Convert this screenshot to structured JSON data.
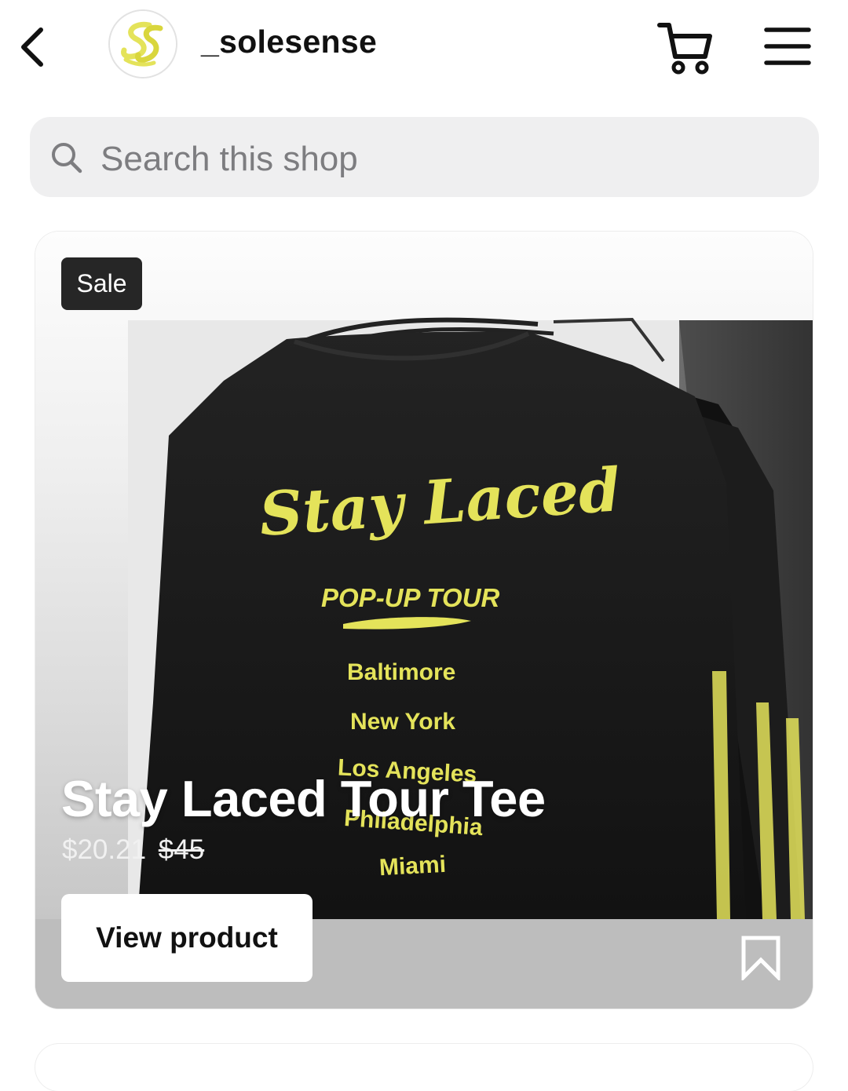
{
  "header": {
    "username": "_solesense",
    "icons": {
      "back": "back-chevron-icon",
      "avatar": "solesense-logo",
      "cart": "cart-icon",
      "menu": "hamburger-menu-icon"
    }
  },
  "search": {
    "placeholder": "Search this shop",
    "icon": "search-icon"
  },
  "product": {
    "badge": "Sale",
    "title": "Stay Laced Tour Tee",
    "price_current": "$20.21",
    "price_original": "$45",
    "cta": "View product",
    "save_icon": "bookmark-icon",
    "shirt_print": {
      "script_title": "Stay Laced",
      "subtitle": "POP-UP TOUR",
      "cities": [
        "Baltimore",
        "New York",
        "Los Angeles",
        "Philadelphia",
        "Miami"
      ]
    }
  },
  "colors": {
    "accent_yellow": "#e4e35a",
    "shirt_black": "#1a1a1a",
    "badge_bg": "#262626"
  }
}
